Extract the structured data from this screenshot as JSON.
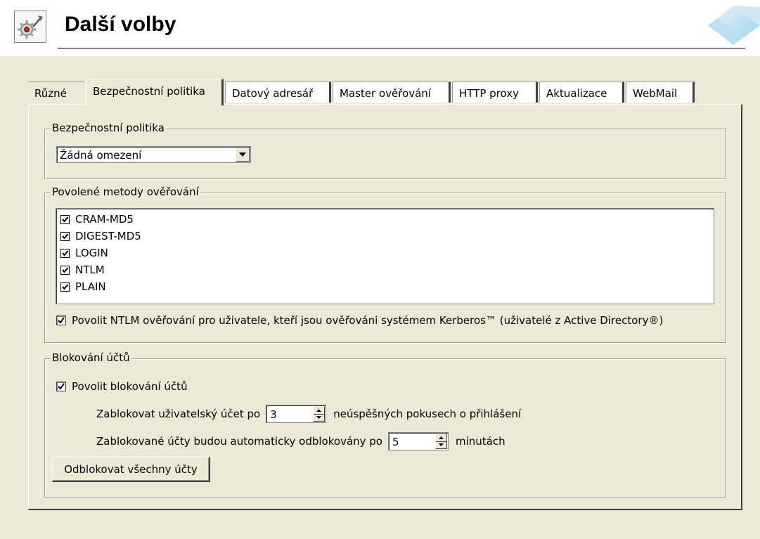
{
  "header": {
    "title": "Další volby",
    "icon": "settings-tools-icon",
    "logo": "brand-logo"
  },
  "tabs": [
    {
      "label": "Různé"
    },
    {
      "label": "Bezpečnostní politika",
      "active": true
    },
    {
      "label": "Datový adresář"
    },
    {
      "label": "Master ověřování"
    },
    {
      "label": "HTTP proxy"
    },
    {
      "label": "Aktualizace"
    },
    {
      "label": "WebMail"
    }
  ],
  "security_policy": {
    "group_label": "Bezpečnostní politika",
    "selected": "Žádná omezení"
  },
  "auth_methods": {
    "group_label": "Povolené metody ověřování",
    "methods": [
      {
        "label": "CRAM-MD5",
        "checked": true
      },
      {
        "label": "DIGEST-MD5",
        "checked": true
      },
      {
        "label": "LOGIN",
        "checked": true
      },
      {
        "label": "NTLM",
        "checked": true
      },
      {
        "label": "PLAIN",
        "checked": true
      }
    ],
    "ntlm_kerberos": {
      "label": "Povolit NTLM ověřování pro uživatele, kteří jsou ověřováni systémem Kerberos™ (uživatelé z Active Directory®)",
      "checked": true
    }
  },
  "account_lockout": {
    "group_label": "Blokování účtů",
    "enable": {
      "label": "Povolit blokování účtů",
      "checked": true
    },
    "lock_after": {
      "prefix": "Zablokovat uživatelský účet po",
      "value": "3",
      "suffix": "neúspěšných pokusech o přihlášení"
    },
    "unlock_after": {
      "prefix": "Zablokované účty budou automaticky odblokovány po",
      "value": "5",
      "suffix": "minutách"
    },
    "unlock_all_button": "Odblokovat všechny účty"
  }
}
